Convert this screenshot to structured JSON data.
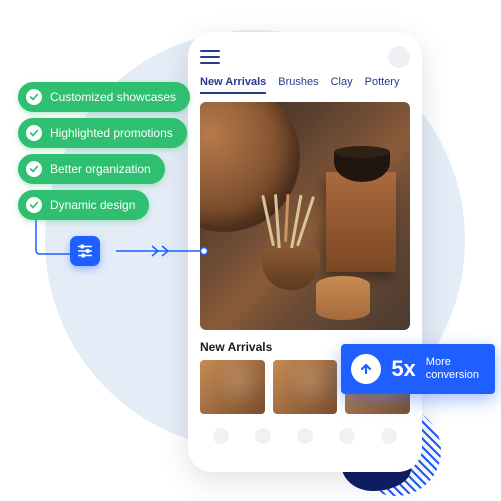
{
  "features": [
    "Customized showcases",
    "Highlighted promotions",
    "Better organization",
    "Dynamic design"
  ],
  "phone": {
    "tabs": [
      "New Arrivals",
      "Brushes",
      "Clay",
      "Pottery"
    ],
    "active_tab_index": 0,
    "section_title": "New Arrivals"
  },
  "conversion": {
    "multiplier": "5x",
    "line1": "More",
    "line2": "conversion"
  },
  "icons": {
    "check": "check-icon",
    "sliders": "sliders-icon",
    "arrow_up": "arrow-up-icon",
    "menu": "menu-icon"
  },
  "colors": {
    "accent_green": "#2fbf71",
    "accent_blue": "#1f5fff",
    "nav_text": "#2b3a8b",
    "bg_circle": "#e4ecf7"
  }
}
